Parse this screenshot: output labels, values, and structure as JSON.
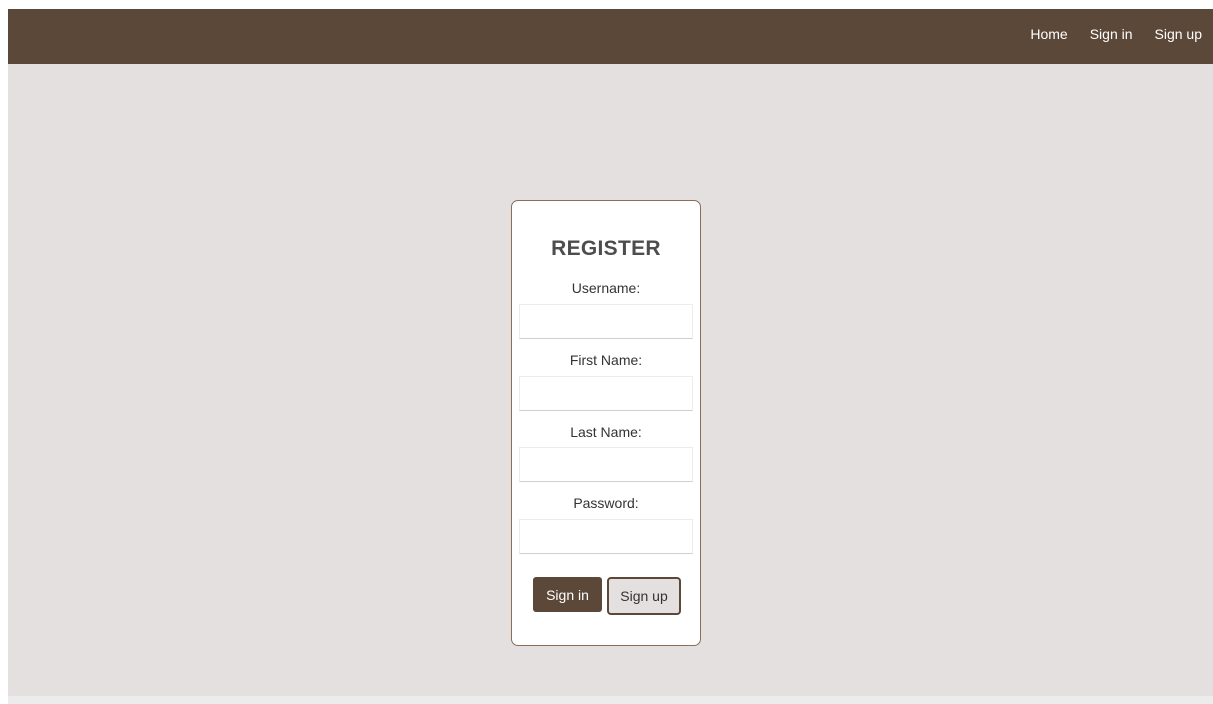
{
  "nav": {
    "links": [
      {
        "label": "Home"
      },
      {
        "label": "Sign in"
      },
      {
        "label": "Sign up"
      }
    ]
  },
  "form": {
    "title": "REGISTER",
    "fields": [
      {
        "label": "Username:",
        "value": "",
        "placeholder": ""
      },
      {
        "label": "First Name:",
        "value": "",
        "placeholder": ""
      },
      {
        "label": "Last Name:",
        "value": "",
        "placeholder": ""
      },
      {
        "label": "Password:",
        "value": "",
        "placeholder": ""
      }
    ],
    "signin_label": "Sign in",
    "signup_label": "Sign up"
  },
  "colors": {
    "nav_background": "#5c4838",
    "page_background": "#e4e0df",
    "card_border": "#8a6e58",
    "primary_button": "#5c4838"
  }
}
